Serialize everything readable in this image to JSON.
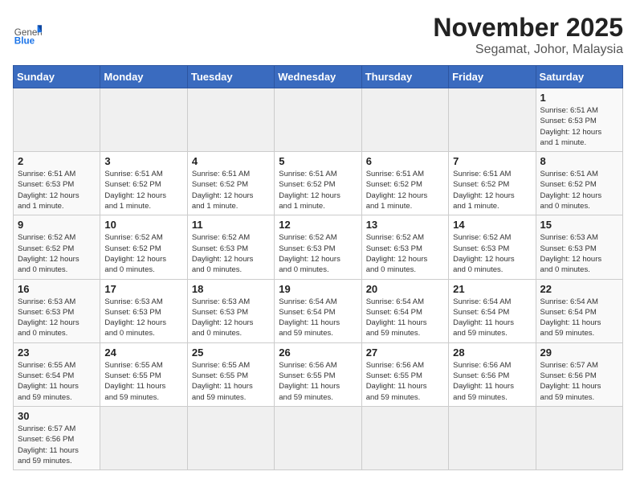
{
  "header": {
    "logo_general": "General",
    "logo_blue": "Blue",
    "month_title": "November 2025",
    "location": "Segamat, Johor, Malaysia"
  },
  "days_of_week": [
    "Sunday",
    "Monday",
    "Tuesday",
    "Wednesday",
    "Thursday",
    "Friday",
    "Saturday"
  ],
  "weeks": [
    [
      {
        "day": "",
        "info": ""
      },
      {
        "day": "",
        "info": ""
      },
      {
        "day": "",
        "info": ""
      },
      {
        "day": "",
        "info": ""
      },
      {
        "day": "",
        "info": ""
      },
      {
        "day": "",
        "info": ""
      },
      {
        "day": "1",
        "info": "Sunrise: 6:51 AM\nSunset: 6:53 PM\nDaylight: 12 hours\nand 1 minute."
      }
    ],
    [
      {
        "day": "2",
        "info": "Sunrise: 6:51 AM\nSunset: 6:53 PM\nDaylight: 12 hours\nand 1 minute."
      },
      {
        "day": "3",
        "info": "Sunrise: 6:51 AM\nSunset: 6:52 PM\nDaylight: 12 hours\nand 1 minute."
      },
      {
        "day": "4",
        "info": "Sunrise: 6:51 AM\nSunset: 6:52 PM\nDaylight: 12 hours\nand 1 minute."
      },
      {
        "day": "5",
        "info": "Sunrise: 6:51 AM\nSunset: 6:52 PM\nDaylight: 12 hours\nand 1 minute."
      },
      {
        "day": "6",
        "info": "Sunrise: 6:51 AM\nSunset: 6:52 PM\nDaylight: 12 hours\nand 1 minute."
      },
      {
        "day": "7",
        "info": "Sunrise: 6:51 AM\nSunset: 6:52 PM\nDaylight: 12 hours\nand 1 minute."
      },
      {
        "day": "8",
        "info": "Sunrise: 6:51 AM\nSunset: 6:52 PM\nDaylight: 12 hours\nand 0 minutes."
      }
    ],
    [
      {
        "day": "9",
        "info": "Sunrise: 6:52 AM\nSunset: 6:52 PM\nDaylight: 12 hours\nand 0 minutes."
      },
      {
        "day": "10",
        "info": "Sunrise: 6:52 AM\nSunset: 6:52 PM\nDaylight: 12 hours\nand 0 minutes."
      },
      {
        "day": "11",
        "info": "Sunrise: 6:52 AM\nSunset: 6:53 PM\nDaylight: 12 hours\nand 0 minutes."
      },
      {
        "day": "12",
        "info": "Sunrise: 6:52 AM\nSunset: 6:53 PM\nDaylight: 12 hours\nand 0 minutes."
      },
      {
        "day": "13",
        "info": "Sunrise: 6:52 AM\nSunset: 6:53 PM\nDaylight: 12 hours\nand 0 minutes."
      },
      {
        "day": "14",
        "info": "Sunrise: 6:52 AM\nSunset: 6:53 PM\nDaylight: 12 hours\nand 0 minutes."
      },
      {
        "day": "15",
        "info": "Sunrise: 6:53 AM\nSunset: 6:53 PM\nDaylight: 12 hours\nand 0 minutes."
      }
    ],
    [
      {
        "day": "16",
        "info": "Sunrise: 6:53 AM\nSunset: 6:53 PM\nDaylight: 12 hours\nand 0 minutes."
      },
      {
        "day": "17",
        "info": "Sunrise: 6:53 AM\nSunset: 6:53 PM\nDaylight: 12 hours\nand 0 minutes."
      },
      {
        "day": "18",
        "info": "Sunrise: 6:53 AM\nSunset: 6:53 PM\nDaylight: 12 hours\nand 0 minutes."
      },
      {
        "day": "19",
        "info": "Sunrise: 6:54 AM\nSunset: 6:54 PM\nDaylight: 11 hours\nand 59 minutes."
      },
      {
        "day": "20",
        "info": "Sunrise: 6:54 AM\nSunset: 6:54 PM\nDaylight: 11 hours\nand 59 minutes."
      },
      {
        "day": "21",
        "info": "Sunrise: 6:54 AM\nSunset: 6:54 PM\nDaylight: 11 hours\nand 59 minutes."
      },
      {
        "day": "22",
        "info": "Sunrise: 6:54 AM\nSunset: 6:54 PM\nDaylight: 11 hours\nand 59 minutes."
      }
    ],
    [
      {
        "day": "23",
        "info": "Sunrise: 6:55 AM\nSunset: 6:54 PM\nDaylight: 11 hours\nand 59 minutes."
      },
      {
        "day": "24",
        "info": "Sunrise: 6:55 AM\nSunset: 6:55 PM\nDaylight: 11 hours\nand 59 minutes."
      },
      {
        "day": "25",
        "info": "Sunrise: 6:55 AM\nSunset: 6:55 PM\nDaylight: 11 hours\nand 59 minutes."
      },
      {
        "day": "26",
        "info": "Sunrise: 6:56 AM\nSunset: 6:55 PM\nDaylight: 11 hours\nand 59 minutes."
      },
      {
        "day": "27",
        "info": "Sunrise: 6:56 AM\nSunset: 6:55 PM\nDaylight: 11 hours\nand 59 minutes."
      },
      {
        "day": "28",
        "info": "Sunrise: 6:56 AM\nSunset: 6:56 PM\nDaylight: 11 hours\nand 59 minutes."
      },
      {
        "day": "29",
        "info": "Sunrise: 6:57 AM\nSunset: 6:56 PM\nDaylight: 11 hours\nand 59 minutes."
      }
    ],
    [
      {
        "day": "30",
        "info": "Sunrise: 6:57 AM\nSunset: 6:56 PM\nDaylight: 11 hours\nand 59 minutes."
      },
      {
        "day": "",
        "info": ""
      },
      {
        "day": "",
        "info": ""
      },
      {
        "day": "",
        "info": ""
      },
      {
        "day": "",
        "info": ""
      },
      {
        "day": "",
        "info": ""
      },
      {
        "day": "",
        "info": ""
      }
    ]
  ]
}
